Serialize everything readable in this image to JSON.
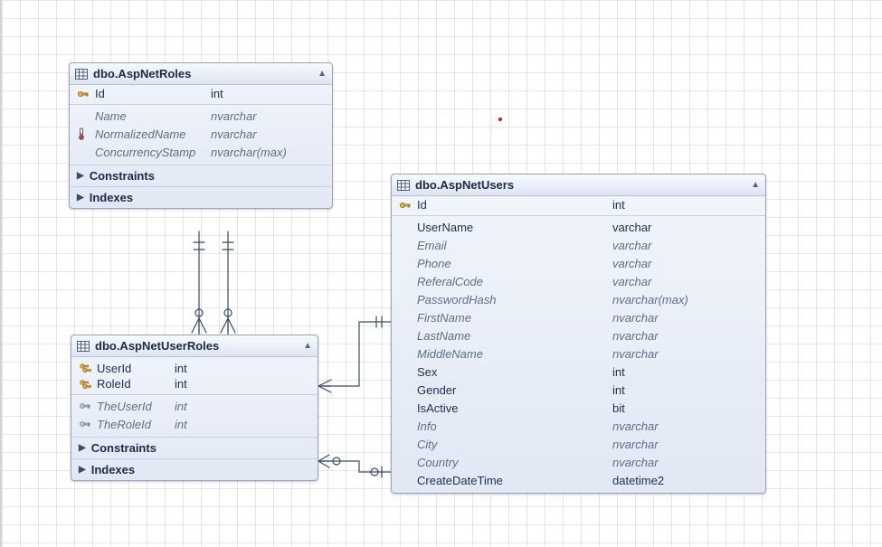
{
  "chart_data": {
    "type": "erd",
    "tables": [
      {
        "id": "roles",
        "name": "dbo.AspNetRoles",
        "position_hint": "top-left",
        "columns": [
          {
            "name": "Id",
            "type": "int",
            "pk": true,
            "nullable": false
          },
          {
            "name": "Name",
            "type": "nvarchar",
            "nullable": true
          },
          {
            "name": "NormalizedName",
            "type": "nvarchar",
            "nullable": true,
            "icon": "thermometer"
          },
          {
            "name": "ConcurrencyStamp",
            "type": "nvarchar(max)",
            "nullable": true
          }
        ],
        "subsections": [
          "Constraints",
          "Indexes"
        ]
      },
      {
        "id": "userroles",
        "name": "dbo.AspNetUserRoles",
        "position_hint": "bottom-left",
        "columns": [
          {
            "name": "UserId",
            "type": "int",
            "pk": true,
            "fk": true,
            "nullable": false
          },
          {
            "name": "RoleId",
            "type": "int",
            "pk": true,
            "fk": true,
            "nullable": false
          },
          {
            "name": "TheUserId",
            "type": "int",
            "fk_gray": true,
            "nullable": true
          },
          {
            "name": "TheRoleId",
            "type": "int",
            "fk_gray": true,
            "nullable": true
          }
        ],
        "subsections": [
          "Constraints",
          "Indexes"
        ]
      },
      {
        "id": "users",
        "name": "dbo.AspNetUsers",
        "position_hint": "right",
        "columns": [
          {
            "name": "Id",
            "type": "int",
            "pk": true,
            "nullable": false
          },
          {
            "name": "UserName",
            "type": "varchar",
            "nullable": false
          },
          {
            "name": "Email",
            "type": "varchar",
            "nullable": true
          },
          {
            "name": "Phone",
            "type": "varchar",
            "nullable": true
          },
          {
            "name": "ReferalCode",
            "type": "varchar",
            "nullable": true
          },
          {
            "name": "PasswordHash",
            "type": "nvarchar(max)",
            "nullable": true
          },
          {
            "name": "FirstName",
            "type": "nvarchar",
            "nullable": true
          },
          {
            "name": "LastName",
            "type": "nvarchar",
            "nullable": true
          },
          {
            "name": "MiddleName",
            "type": "nvarchar",
            "nullable": true
          },
          {
            "name": "Sex",
            "type": "int",
            "nullable": false
          },
          {
            "name": "Gender",
            "type": "int",
            "nullable": false
          },
          {
            "name": "IsActive",
            "type": "bit",
            "nullable": false
          },
          {
            "name": "Info",
            "type": "nvarchar",
            "nullable": true
          },
          {
            "name": "City",
            "type": "nvarchar",
            "nullable": true
          },
          {
            "name": "Country",
            "type": "nvarchar",
            "nullable": true
          },
          {
            "name": "CreateDateTime",
            "type": "datetime2",
            "nullable": false
          }
        ],
        "subsections": []
      }
    ],
    "relationships": [
      {
        "from": "userroles.RoleId",
        "to": "roles.Id",
        "cardinality": "many-to-one"
      },
      {
        "from": "userroles.TheRoleId",
        "to": "roles.Id",
        "cardinality": "zero-or-many-to-zero-or-one"
      },
      {
        "from": "userroles.UserId",
        "to": "users.Id",
        "cardinality": "many-to-one"
      },
      {
        "from": "userroles.TheUserId",
        "to": "users.Id",
        "cardinality": "zero-or-many-to-zero-or-one"
      }
    ]
  },
  "tables": {
    "roles": {
      "title": "dbo.AspNetRoles",
      "cols": [
        {
          "n": "Id",
          "t": "int"
        },
        {
          "n": "Name",
          "t": "nvarchar"
        },
        {
          "n": "NormalizedName",
          "t": "nvarchar"
        },
        {
          "n": "ConcurrencyStamp",
          "t": "nvarchar(max)"
        }
      ],
      "constraints_label": "Constraints",
      "indexes_label": "Indexes"
    },
    "userroles": {
      "title": "dbo.AspNetUserRoles",
      "cols": [
        {
          "n": "UserId",
          "t": "int"
        },
        {
          "n": "RoleId",
          "t": "int"
        },
        {
          "n": "TheUserId",
          "t": "int"
        },
        {
          "n": "TheRoleId",
          "t": "int"
        }
      ],
      "constraints_label": "Constraints",
      "indexes_label": "Indexes"
    },
    "users": {
      "title": "dbo.AspNetUsers",
      "cols": [
        {
          "n": "Id",
          "t": "int"
        },
        {
          "n": "UserName",
          "t": "varchar"
        },
        {
          "n": "Email",
          "t": "varchar"
        },
        {
          "n": "Phone",
          "t": "varchar"
        },
        {
          "n": "ReferalCode",
          "t": "varchar"
        },
        {
          "n": "PasswordHash",
          "t": "nvarchar(max)"
        },
        {
          "n": "FirstName",
          "t": "nvarchar"
        },
        {
          "n": "LastName",
          "t": "nvarchar"
        },
        {
          "n": "MiddleName",
          "t": "nvarchar"
        },
        {
          "n": "Sex",
          "t": "int"
        },
        {
          "n": "Gender",
          "t": "int"
        },
        {
          "n": "IsActive",
          "t": "bit"
        },
        {
          "n": "Info",
          "t": "nvarchar"
        },
        {
          "n": "City",
          "t": "nvarchar"
        },
        {
          "n": "Country",
          "t": "nvarchar"
        },
        {
          "n": "CreateDateTime",
          "t": "datetime2"
        }
      ]
    }
  },
  "colors": {
    "line": "#3a4a6a",
    "line_optional": "#7a889f"
  }
}
